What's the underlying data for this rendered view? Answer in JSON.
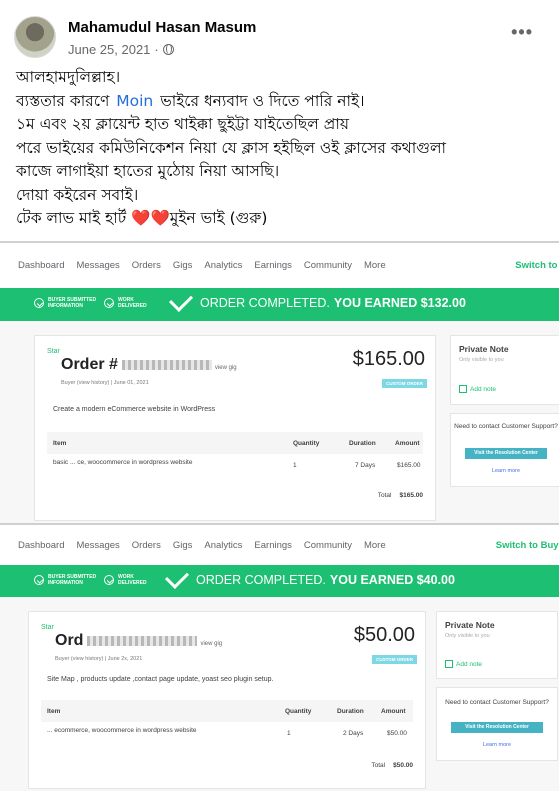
{
  "post": {
    "author": "Mahamudul Hasan Masum",
    "date": "June 25, 2021",
    "separator": "·",
    "more_label": "•••",
    "lines": [
      "আলহামদুলিল্লাহ।",
      "ব্যস্ততার কারণে",
      "১ম এবং ২য় ক্লায়েন্ট হাত থাইক্কা ছুইট্টা যাইতেছিল প্রায়",
      "পরে ভাইয়ের কমিউনিকেশন নিয়া যে ক্লাস হইছিল ওই ক্লাসের কথাগুলা",
      "কাজে লাগাইয়া হাতের মুঠোয় নিয়া আসছি।",
      "দোয়া কইরেন সবাই।",
      "টেক লাভ মাই হার্ট"
    ],
    "mention": "Moin",
    "line2_after": "ভাইরে ধন্যবাদ ও দিতে পারি নাই।",
    "hearts": "❤️❤️",
    "line7_after": "মুইন ভাই (গুরু)"
  },
  "nav": {
    "items": [
      "Dashboard",
      "Messages",
      "Orders",
      "Gigs",
      "Analytics",
      "Earnings",
      "Community",
      "More"
    ],
    "switch_1": "Switch to B",
    "switch_2": "Switch to Buyin"
  },
  "banner": {
    "step1": "BUYER SUBMITTED INFORMATION",
    "step2": "WORK DELIVERED",
    "title": "ORDER COMPLETED."
  },
  "common": {
    "star": "Star",
    "custom_order": "CUSTOM ORDER",
    "col_item": "Item",
    "col_qty": "Quantity",
    "col_dur": "Duration",
    "col_amount": "Amount",
    "total_label": "Total",
    "private_note": "Private Note",
    "private_sub": "Only visible to you",
    "add_note": "Add note",
    "support": "Need to contact Customer Support?",
    "resolution": "Visit the Resolution Center",
    "learn_more": "Learn more"
  },
  "orders": [
    {
      "earned": "YOU EARNED $132.00",
      "title": "Order #",
      "view_link": "view gig",
      "buyer": "Buyer          (view history)  |  June 01, 2021",
      "price": "$165.00",
      "description": "Create a modern eCommerce website in WordPress",
      "item": "basic      ...      ce, woocommerce in wordpress website",
      "qty": "1",
      "duration": "7 Days",
      "amount": "$165.00",
      "total": "$165.00"
    },
    {
      "earned": "YOU EARNED $40.00",
      "title": "Ord",
      "view_link": "view gig",
      "buyer": "Buyer          (view history)  |  June 2x, 2021",
      "price": "$50.00",
      "description": "Site Map , products update ,contact page update, yoast seo plugin setup.",
      "item": "...     ecommerce, woocommerce in wordpress website",
      "qty": "1",
      "duration": "2 Days",
      "amount": "$50.00",
      "total": "$50.00"
    }
  ]
}
